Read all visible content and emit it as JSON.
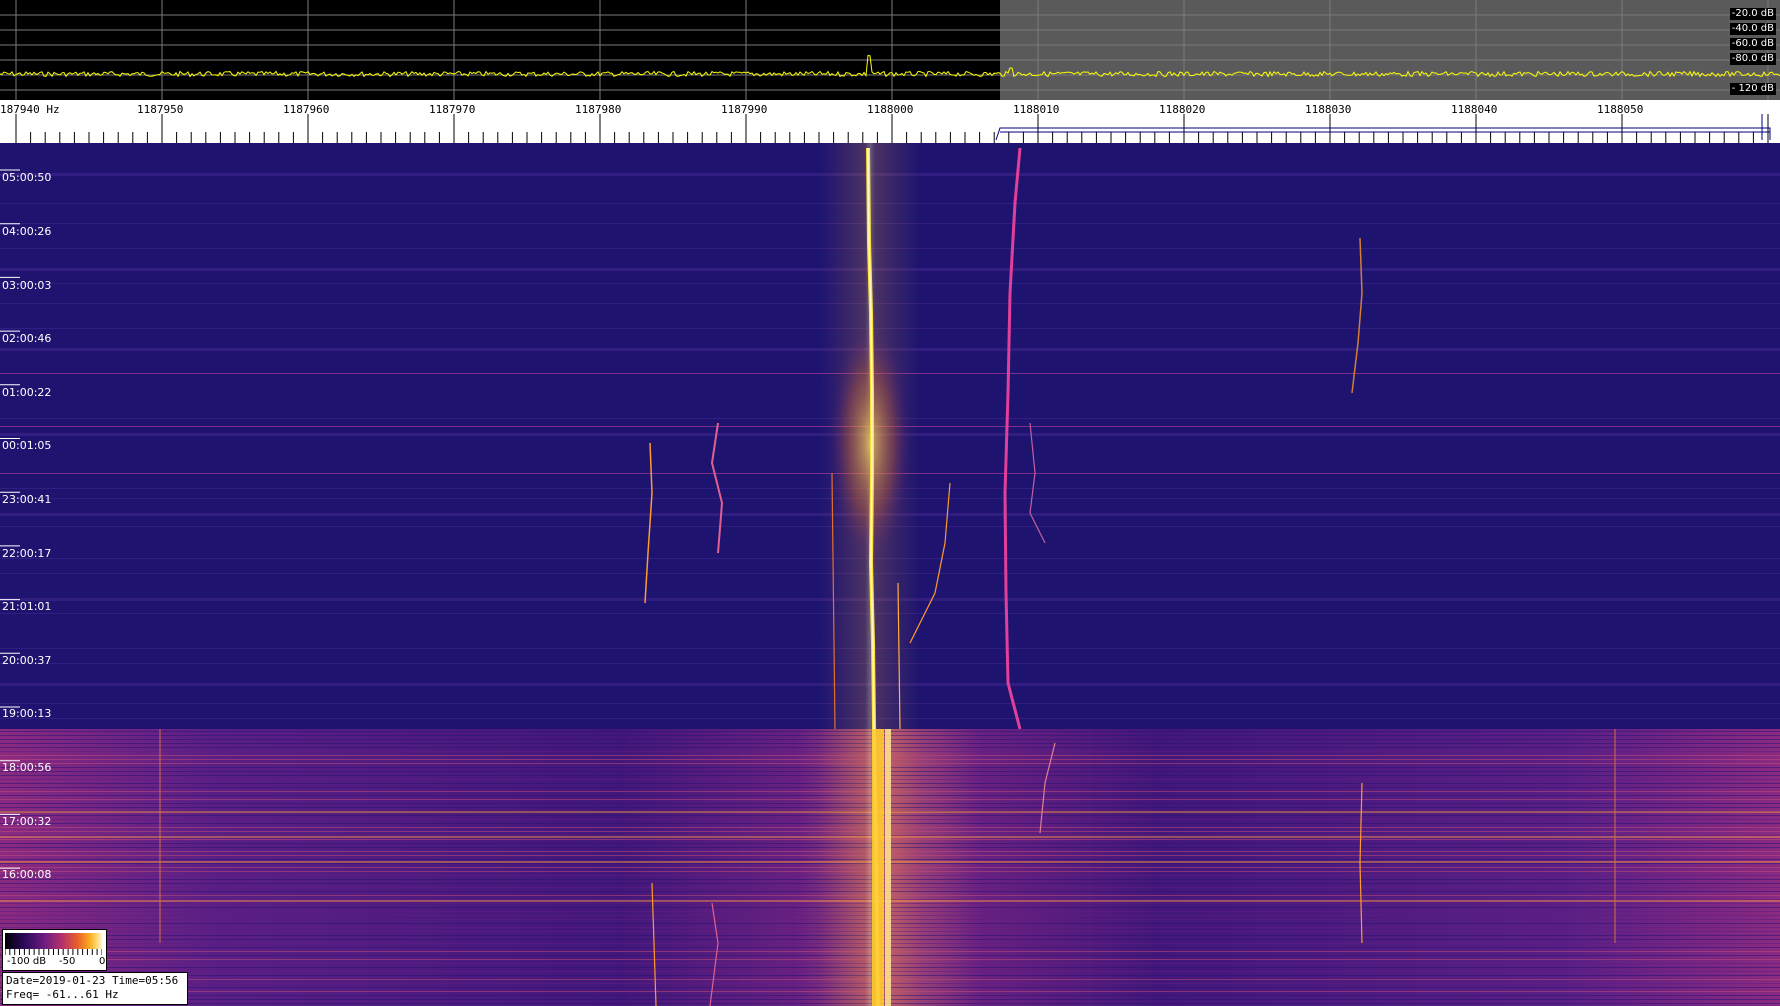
{
  "colors": {
    "waterfall_background": "#1e1470",
    "spectrum_background": "#000000",
    "spectrum_shaded": "#5a5a5a",
    "spectrum_trace": "#ffff00",
    "signal": "#fff06a"
  },
  "spectrum": {
    "db_labels": [
      "-20.0 dB",
      "-40.0 dB",
      "-60.0 dB",
      "-80.0 dB",
      "- 120 dB"
    ]
  },
  "frequency_axis": {
    "labels": [
      "187940 Hz",
      "1187950",
      "1187960",
      "1187970",
      "1187980",
      "1187990",
      "1188000",
      "1188010",
      "1188020",
      "1188030",
      "1188040",
      "1188050"
    ]
  },
  "waterfall": {
    "time_labels": [
      "05:00:50",
      "04:00:26",
      "03:00:03",
      "02:00:46",
      "01:00:22",
      "00:01:05",
      "23:00:41",
      "22:00:17",
      "21:01:01",
      "20:00:37",
      "19:00:13",
      "18:00:56",
      "17:00:32",
      "16:00:08"
    ]
  },
  "color_scale": {
    "labels": [
      "-100 dB",
      "-50",
      "0"
    ]
  },
  "info": {
    "date_time": "Date=2019-01-23 Time=05:56",
    "freq_range": "Freq= -61...61 Hz"
  }
}
